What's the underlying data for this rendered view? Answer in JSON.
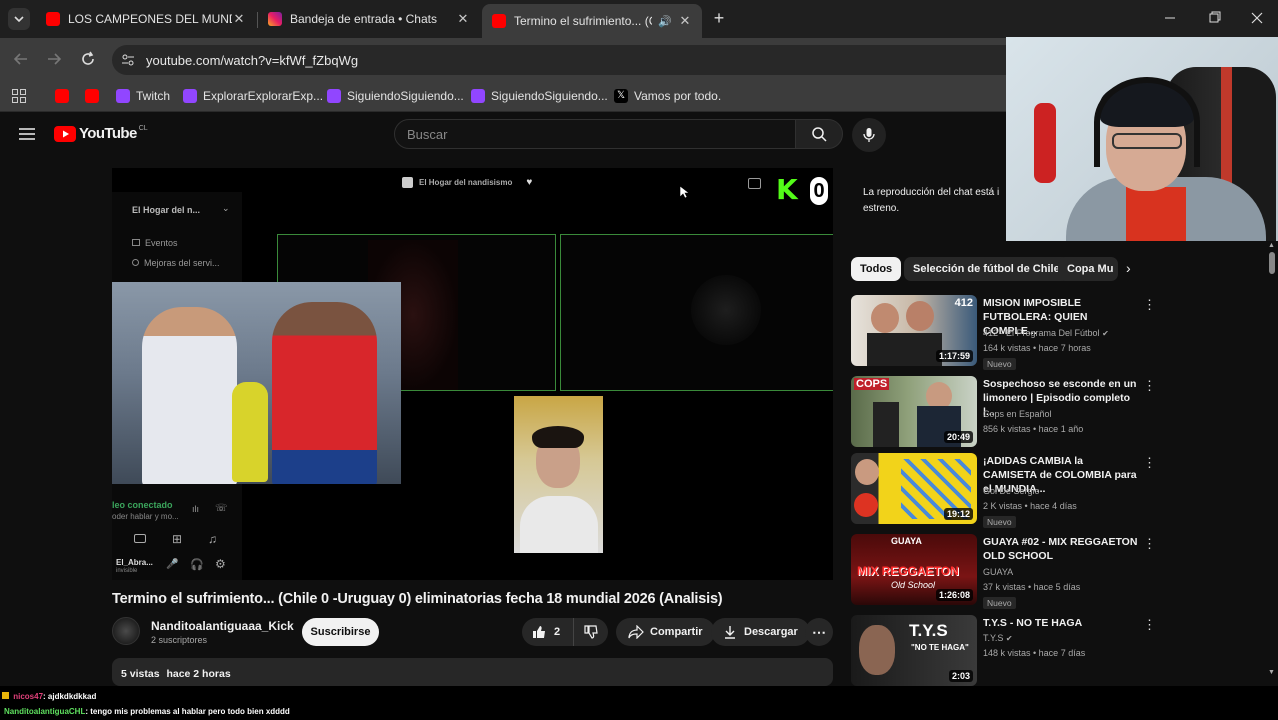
{
  "browser": {
    "tabs": [
      {
        "title": "LOS CAMPEONES DEL MUNDO",
        "type": "youtube"
      },
      {
        "title": "Bandeja de entrada • Chats",
        "type": "instagram"
      },
      {
        "title": "Termino el sufrimiento... (Ch",
        "type": "youtube",
        "active": true
      }
    ],
    "url": "youtube.com/watch?v=kfWf_fZbqWg",
    "bookmarks": [
      {
        "label": "",
        "icon": "youtube-icon"
      },
      {
        "label": "",
        "icon": "youtube-icon"
      },
      {
        "label": "Twitch",
        "icon": "twitch-icon"
      },
      {
        "label": "ExplorarExplorarExp...",
        "icon": "twitch-icon"
      },
      {
        "label": "SiguiendoSiguiendo...",
        "icon": "twitch-icon"
      },
      {
        "label": "SiguiendoSiguiendo...",
        "icon": "twitch-icon"
      },
      {
        "label": "Vamos por todo.",
        "icon": "x-icon"
      }
    ]
  },
  "youtube": {
    "logo_text": "YouTube",
    "region": "CL",
    "search_placeholder": "Buscar"
  },
  "video": {
    "overlay_server": "El Hogar del nandisismo",
    "sidebar_server": "El Hogar del n...",
    "sidebar_items": [
      "Eventos",
      "Mejoras del servi..."
    ],
    "voice_status": "leo conectado",
    "voice_sub": "oder hablar y mo...",
    "user_name": "El_Abra...",
    "user_status": "invisible",
    "kick_letter": "K",
    "kick_number": "0",
    "title": "Termino el sufrimiento... (Chile 0 -Uruguay 0) eliminatorias fecha 18 mundial 2026 (Analisis)"
  },
  "channel": {
    "name": "Nanditoalantiguaaa_Kick",
    "subs": "2 suscriptores",
    "subscribe_label": "Suscribirse"
  },
  "actions": {
    "likes": "2",
    "share": "Compartir",
    "download": "Descargar"
  },
  "description": {
    "views": "5 vistas",
    "age": "hace 2 horas"
  },
  "chat": {
    "replay_msg_line1": "La reproducción del chat está i",
    "replay_msg_line2": "estreno."
  },
  "chips": [
    "Todos",
    "Selección de fútbol de Chile",
    "Copa Mu"
  ],
  "recommendations": [
    {
      "title": "MISION IMPOSIBLE FUTBOLERA: QUIEN COMPLE...",
      "channel": "412 - El Programa Del Fútbol",
      "verified": true,
      "meta": "164 k vistas • hace 7 horas",
      "duration": "1:17:59",
      "badge": "Nuevo"
    },
    {
      "title": "Sospechoso se esconde en un limonero | Episodio completo |...",
      "channel": "Cops en Español",
      "verified": false,
      "meta": "856 k vistas • hace 1 año",
      "duration": "20:49",
      "badge": ""
    },
    {
      "title": "¡ADIDAS CAMBIA la CAMISETA de COLOMBIA para el MUNDIA...",
      "channel": "Gol De Sergio",
      "verified": false,
      "meta": "2 K vistas • hace 4 días",
      "duration": "19:12",
      "badge": "Nuevo"
    },
    {
      "title": "GUAYA #02 - MIX REGGAETON OLD SCHOOL",
      "channel": "GUAYA",
      "verified": false,
      "meta": "37 k vistas • hace 5 días",
      "duration": "1:26:08",
      "badge": "Nuevo"
    },
    {
      "title": "T.Y.S - NO TE HAGA",
      "channel": "T.Y.S",
      "verified": true,
      "meta": "148 k vistas • hace 7 días",
      "duration": "2:03",
      "badge": ""
    }
  ],
  "thumb_text": {
    "r0": "412",
    "r1": "COPS",
    "r3a": "GUAYA",
    "r3b": "MIX REGGAETON",
    "r3c": "Old School",
    "r4a": "T.Y.S",
    "r4b": "\"NO TE HAGA\""
  },
  "overlay_chat": [
    {
      "user": "nicos47",
      "msg": ": ajdkdkdkkad",
      "color": "#e0407a"
    },
    {
      "user": "NanditoalantiguaCHL",
      "msg": ": tengo mis problemas al hablar pero todo bien xdddd",
      "color": "#5fe05f"
    }
  ],
  "colors": {
    "kick_green": "#53fc18",
    "yt_red": "#ff0000",
    "twitch_purple": "#9146ff"
  }
}
